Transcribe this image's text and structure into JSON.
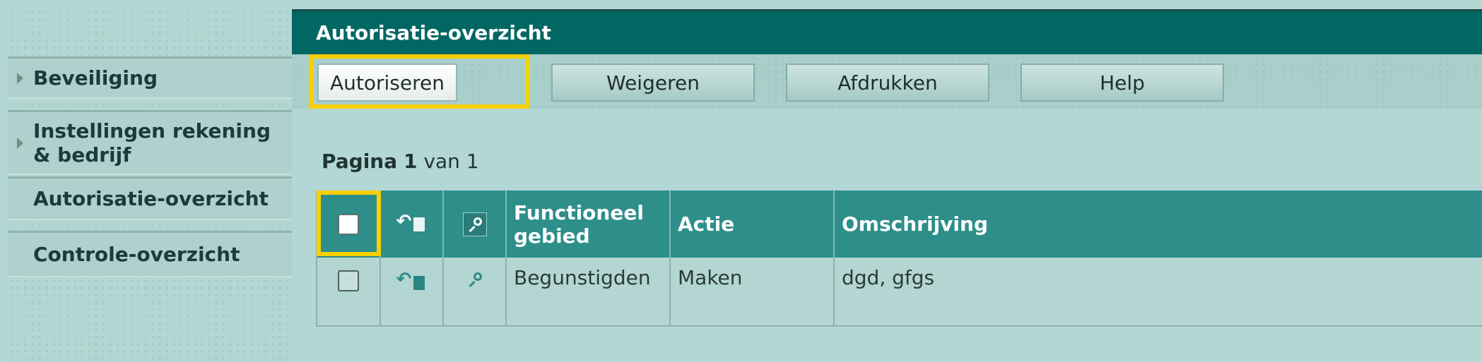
{
  "sidebar": {
    "items": [
      {
        "label": "Beveiliging",
        "has_arrow": true
      },
      {
        "label": "Instellingen rekening & bedrijf",
        "has_arrow": true
      },
      {
        "label": "Autorisatie-overzicht",
        "has_arrow": false
      },
      {
        "label": "Controle-overzicht",
        "has_arrow": false
      }
    ]
  },
  "main": {
    "title": "Autorisatie-overzicht",
    "toolbar": {
      "autoriseren": "Autoriseren",
      "weigeren": "Weigeren",
      "afdrukken": "Afdrukken",
      "help": "Help"
    },
    "pagination": {
      "page_word": "Pagina",
      "current": "1",
      "of_word": "van",
      "total": "1"
    },
    "table": {
      "headers": {
        "functioneel_gebied": "Functioneel gebied",
        "actie": "Actie",
        "omschrijving": "Omschrijving"
      },
      "header_icons": [
        "select-all-checkbox",
        "undo-document-icon",
        "search-icon"
      ],
      "rows": [
        {
          "checked": false,
          "functioneel_gebied": "Begunstigden",
          "actie": "Maken",
          "omschrijving": "dgd, gfgs"
        }
      ]
    }
  },
  "colors": {
    "title_bar": "#006763",
    "table_header": "#2d8e8a",
    "highlight": "#f8cf00",
    "background": "#b3d7d5"
  }
}
